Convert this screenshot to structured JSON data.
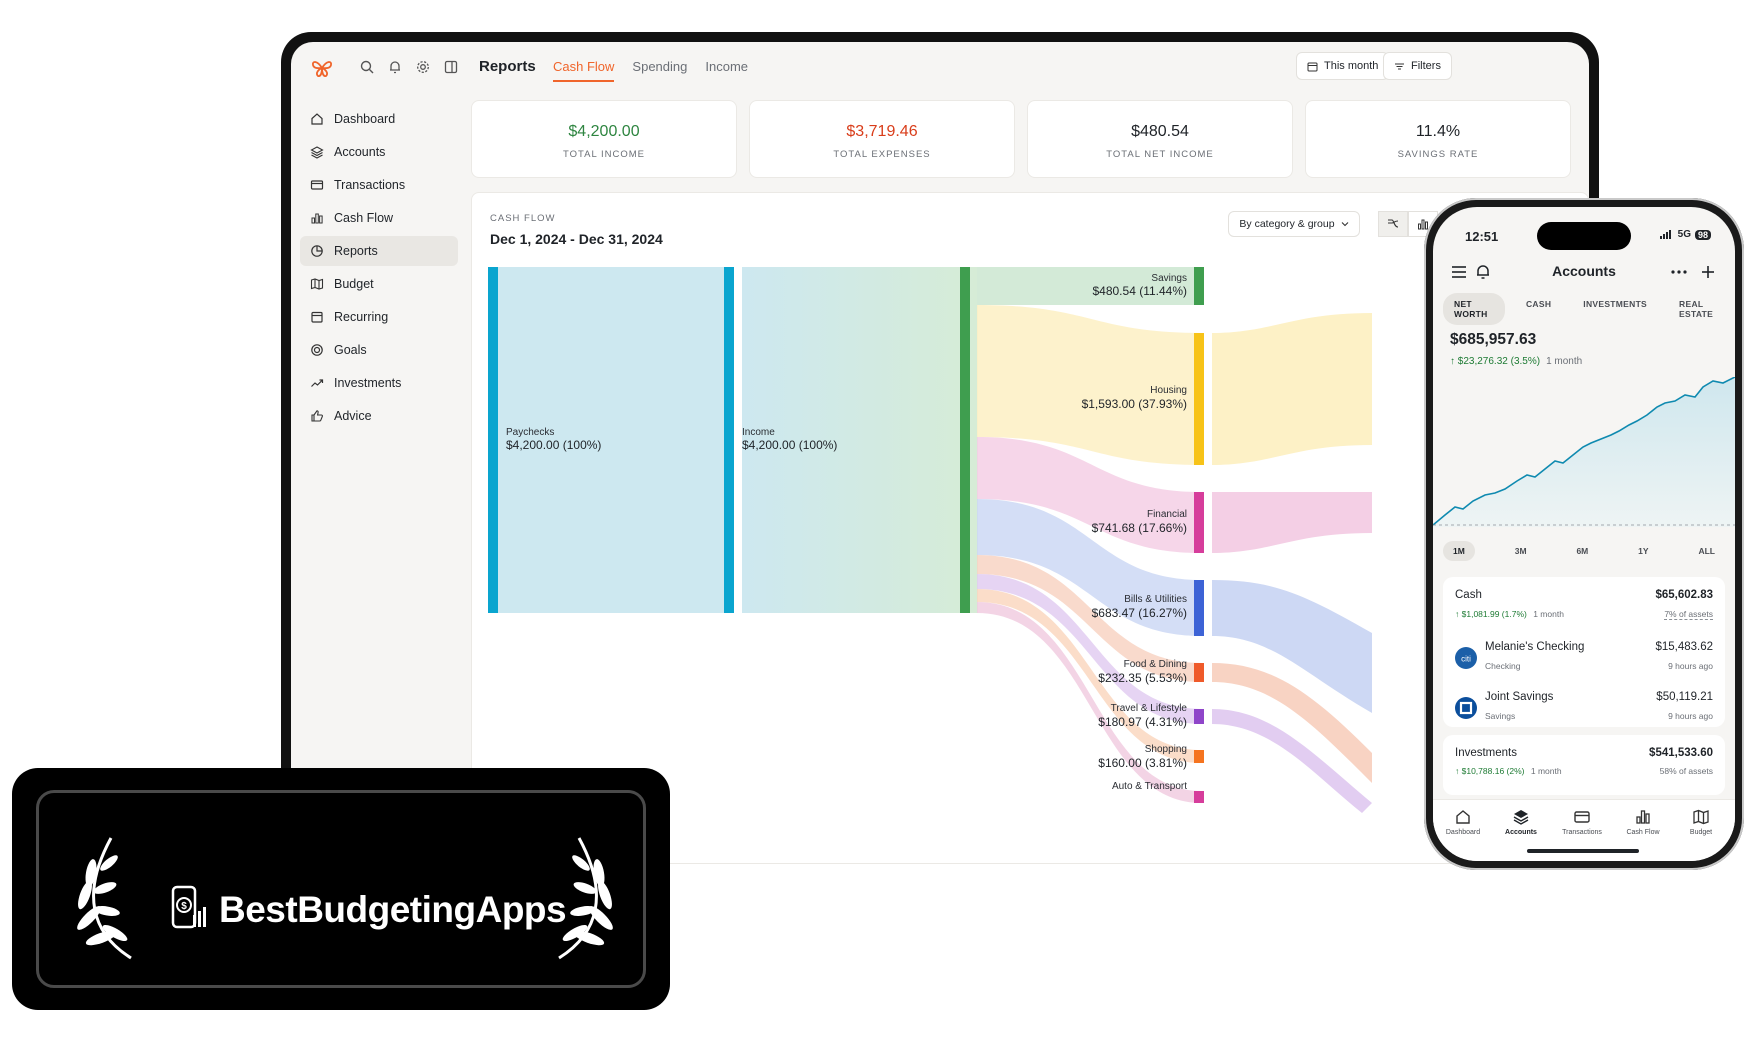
{
  "app": {
    "page_title": "Reports",
    "tabs": [
      {
        "label": "Cash Flow",
        "active": true
      },
      {
        "label": "Spending",
        "active": false
      },
      {
        "label": "Income",
        "active": false
      }
    ],
    "buttons": {
      "period": "This month",
      "filters": "Filters"
    },
    "accent_color": "#f0652b"
  },
  "sidebar": {
    "items": [
      {
        "label": "Dashboard",
        "icon": "home-icon"
      },
      {
        "label": "Accounts",
        "icon": "layers-icon"
      },
      {
        "label": "Transactions",
        "icon": "card-icon"
      },
      {
        "label": "Cash Flow",
        "icon": "bar-chart-icon"
      },
      {
        "label": "Reports",
        "icon": "pie-chart-icon",
        "active": true
      },
      {
        "label": "Budget",
        "icon": "map-icon"
      },
      {
        "label": "Recurring",
        "icon": "calendar-icon"
      },
      {
        "label": "Goals",
        "icon": "target-icon"
      },
      {
        "label": "Investments",
        "icon": "trend-icon"
      },
      {
        "label": "Advice",
        "icon": "thumbs-up-icon"
      }
    ]
  },
  "stats": [
    {
      "value": "$4,200.00",
      "label": "TOTAL INCOME",
      "color": "#2e8540"
    },
    {
      "value": "$3,719.46",
      "label": "TOTAL EXPENSES",
      "color": "#d93d1a"
    },
    {
      "value": "$480.54",
      "label": "TOTAL NET INCOME",
      "color": "#1f2328"
    },
    {
      "value": "11.4%",
      "label": "SAVINGS RATE",
      "color": "#1f2328"
    }
  ],
  "cashflow": {
    "label": "CASH FLOW",
    "range": "Dec 1, 2024 - Dec 31, 2024",
    "group_by": "By category & group"
  },
  "sankey": {
    "sources": [
      {
        "name": "Paychecks",
        "value": "$4,200.00 (100%)",
        "color": "#0aa5cf"
      },
      {
        "name": "Income",
        "value": "$4,200.00 (100%)",
        "color": "#0aa5cf"
      }
    ],
    "categories": [
      {
        "name": "Savings",
        "value": "$480.54 (11.44%)",
        "color": "#3f9e4f"
      },
      {
        "name": "Housing",
        "value": "$1,593.00 (37.93%)",
        "color": "#f7c318"
      },
      {
        "name": "Financial",
        "value": "$741.68 (17.66%)",
        "color": "#d63d9b"
      },
      {
        "name": "Bills & Utilities",
        "value": "$683.47 (16.27%)",
        "color": "#3d63d6"
      },
      {
        "name": "Food & Dining",
        "value": "$232.35 (5.53%)",
        "color": "#ef5a2a"
      },
      {
        "name": "Travel & Lifestyle",
        "value": "$180.97 (4.31%)",
        "color": "#8f45c9"
      },
      {
        "name": "Shopping",
        "value": "$160.00 (3.81%)",
        "color": "#f5741f"
      },
      {
        "name": "Auto & Transport",
        "value": "",
        "color": "#d63d9b"
      }
    ]
  },
  "phone": {
    "time": "12:51",
    "network": "5G",
    "battery": "98",
    "title": "Accounts",
    "tabs": [
      {
        "label": "NET WORTH",
        "active": true
      },
      {
        "label": "CASH",
        "active": false
      },
      {
        "label": "INVESTMENTS",
        "active": false
      },
      {
        "label": "REAL ESTATE",
        "active": false
      }
    ],
    "net_worth": "$685,957.63",
    "change": "$23,276.32 (3.5%)",
    "change_period": "1 month",
    "ranges": [
      {
        "label": "1M",
        "active": true
      },
      {
        "label": "3M",
        "active": false
      },
      {
        "label": "6M",
        "active": false
      },
      {
        "label": "1Y",
        "active": false
      },
      {
        "label": "ALL",
        "active": false
      }
    ],
    "cash": {
      "title": "Cash",
      "amount": "$65,602.83",
      "change": "$1,081.99 (1.7%)",
      "period": "1 month",
      "share": "7% of assets",
      "accounts": [
        {
          "name": "Melanie's Checking",
          "type": "Checking",
          "amount": "$15,483.62",
          "updated": "9 hours ago",
          "logo_text": "citi"
        },
        {
          "name": "Joint Savings",
          "type": "Savings",
          "amount": "$50,119.21",
          "updated": "9 hours ago",
          "logo_text": ""
        }
      ]
    },
    "investments": {
      "title": "Investments",
      "amount": "$541,533.60",
      "change": "$10,788.16 (2%)",
      "period": "1 month",
      "share": "58% of assets"
    },
    "tabbar": [
      {
        "label": "Dashboard",
        "icon": "home-icon"
      },
      {
        "label": "Accounts",
        "icon": "layers-icon",
        "active": true
      },
      {
        "label": "Transactions",
        "icon": "card-icon"
      },
      {
        "label": "Cash Flow",
        "icon": "bar-chart-icon"
      },
      {
        "label": "Budget",
        "icon": "map-icon"
      }
    ]
  },
  "badge": {
    "text": "BestBudgetingApps"
  }
}
